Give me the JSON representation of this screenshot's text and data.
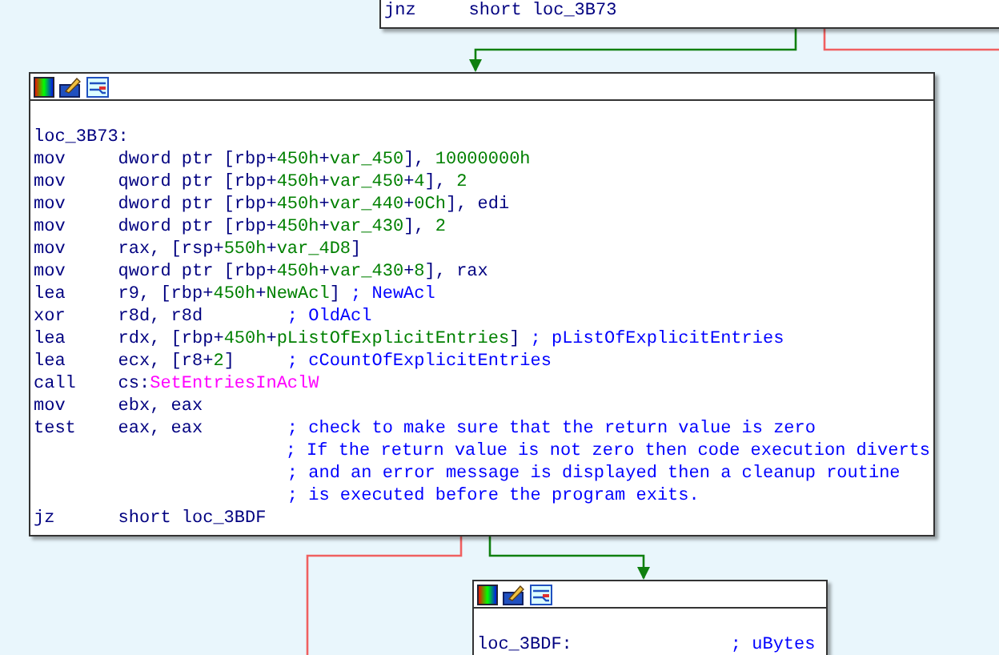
{
  "nodes": [
    {
      "kind": "tail",
      "lines": [
        {
          "mnemonic": "jnz",
          "operands": [
            {
              "text": "short loc_3B73",
              "kind": "plain"
            }
          ]
        }
      ]
    },
    {
      "kind": "block",
      "label": "loc_3B73:",
      "lines": [
        {
          "mnemonic": "mov",
          "operands": [
            {
              "text": "dword ptr [rbp+",
              "kind": "plain"
            },
            {
              "text": "450h",
              "kind": "num"
            },
            {
              "text": "+",
              "kind": "plain"
            },
            {
              "text": "var_450",
              "kind": "num"
            },
            {
              "text": "], ",
              "kind": "plain"
            },
            {
              "text": "10000000h",
              "kind": "num"
            }
          ]
        },
        {
          "mnemonic": "mov",
          "operands": [
            {
              "text": "qword ptr [rbp+",
              "kind": "plain"
            },
            {
              "text": "450h",
              "kind": "num"
            },
            {
              "text": "+",
              "kind": "plain"
            },
            {
              "text": "var_450",
              "kind": "num"
            },
            {
              "text": "+",
              "kind": "plain"
            },
            {
              "text": "4",
              "kind": "num"
            },
            {
              "text": "], ",
              "kind": "plain"
            },
            {
              "text": "2",
              "kind": "num"
            }
          ]
        },
        {
          "mnemonic": "mov",
          "operands": [
            {
              "text": "dword ptr [rbp+",
              "kind": "plain"
            },
            {
              "text": "450h",
              "kind": "num"
            },
            {
              "text": "+",
              "kind": "plain"
            },
            {
              "text": "var_440",
              "kind": "num"
            },
            {
              "text": "+",
              "kind": "plain"
            },
            {
              "text": "0Ch",
              "kind": "num"
            },
            {
              "text": "], edi",
              "kind": "plain"
            }
          ]
        },
        {
          "mnemonic": "mov",
          "operands": [
            {
              "text": "dword ptr [rbp+",
              "kind": "plain"
            },
            {
              "text": "450h",
              "kind": "num"
            },
            {
              "text": "+",
              "kind": "plain"
            },
            {
              "text": "var_430",
              "kind": "num"
            },
            {
              "text": "], ",
              "kind": "plain"
            },
            {
              "text": "2",
              "kind": "num"
            }
          ]
        },
        {
          "mnemonic": "mov",
          "operands": [
            {
              "text": "rax, [rsp+",
              "kind": "plain"
            },
            {
              "text": "550h",
              "kind": "num"
            },
            {
              "text": "+",
              "kind": "plain"
            },
            {
              "text": "var_4D8",
              "kind": "num"
            },
            {
              "text": "]",
              "kind": "plain"
            }
          ]
        },
        {
          "mnemonic": "mov",
          "operands": [
            {
              "text": "qword ptr [rbp+",
              "kind": "plain"
            },
            {
              "text": "450h",
              "kind": "num"
            },
            {
              "text": "+",
              "kind": "plain"
            },
            {
              "text": "var_430",
              "kind": "num"
            },
            {
              "text": "+",
              "kind": "plain"
            },
            {
              "text": "8",
              "kind": "num"
            },
            {
              "text": "], rax",
              "kind": "plain"
            }
          ]
        },
        {
          "mnemonic": "lea",
          "operands": [
            {
              "text": "r9, [rbp+",
              "kind": "plain"
            },
            {
              "text": "450h",
              "kind": "num"
            },
            {
              "text": "+",
              "kind": "plain"
            },
            {
              "text": "NewAcl",
              "kind": "num"
            },
            {
              "text": "]",
              "kind": "plain"
            },
            {
              "text": "; NewAcl",
              "kind": "comment"
            }
          ]
        },
        {
          "mnemonic": "xor",
          "operands": [
            {
              "text": "r8d, r8d",
              "kind": "plain"
            }
          ],
          "comment": "; OldAcl"
        },
        {
          "mnemonic": "lea",
          "operands": [
            {
              "text": "rdx, [rbp+",
              "kind": "plain"
            },
            {
              "text": "450h",
              "kind": "num"
            },
            {
              "text": "+",
              "kind": "plain"
            },
            {
              "text": "pListOfExplicitEntries",
              "kind": "num"
            },
            {
              "text": "]",
              "kind": "plain"
            },
            {
              "text": "; pListOfExplicitEntries",
              "kind": "comment"
            }
          ]
        },
        {
          "mnemonic": "lea",
          "operands": [
            {
              "text": "ecx, [r8+",
              "kind": "plain"
            },
            {
              "text": "2",
              "kind": "num"
            },
            {
              "text": "]",
              "kind": "plain"
            }
          ],
          "comment": "; cCountOfExplicitEntries"
        },
        {
          "mnemonic": "call",
          "operands": [
            {
              "text": "cs:",
              "kind": "plain"
            },
            {
              "text": "SetEntriesInAclW",
              "kind": "import"
            }
          ]
        },
        {
          "mnemonic": "mov",
          "operands": [
            {
              "text": "ebx, eax",
              "kind": "plain"
            }
          ]
        },
        {
          "mnemonic": "test",
          "operands": [
            {
              "text": "eax, eax",
              "kind": "plain"
            }
          ],
          "comment": "; check to make sure that the return value is zero"
        },
        {
          "comment": "; If the return value is not zero then code execution diverts"
        },
        {
          "comment": "; and an error message is displayed then a cleanup routine"
        },
        {
          "comment": "; is executed before the program exits."
        },
        {
          "mnemonic": "jz",
          "operands": [
            {
              "text": "short loc_3BDF",
              "kind": "plain"
            }
          ]
        }
      ]
    },
    {
      "kind": "block",
      "label": "loc_3BDF:",
      "label_comment": "; uBytes"
    }
  ],
  "edges": [
    {
      "kind": "true"
    },
    {
      "kind": "false"
    },
    {
      "kind": "false"
    },
    {
      "kind": "true"
    }
  ]
}
